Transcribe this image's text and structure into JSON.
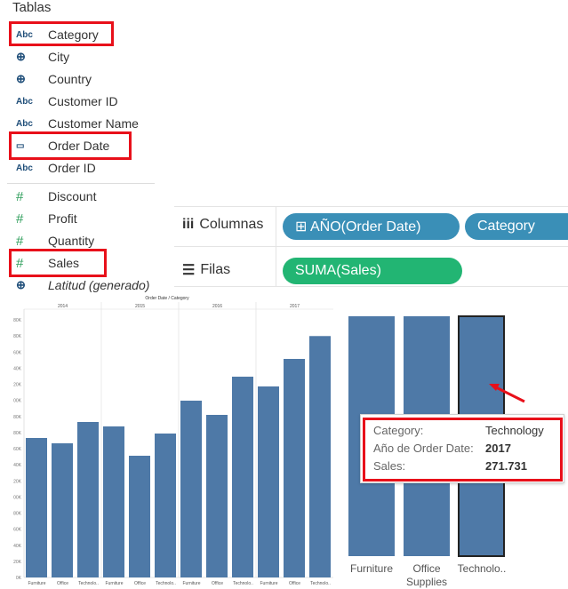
{
  "data_pane": {
    "title": "Tablas",
    "dimensions": [
      {
        "icon": "Abc",
        "icon_name": "string-icon",
        "name": "Category"
      },
      {
        "icon": "⊕",
        "icon_name": "globe-icon",
        "name": "City"
      },
      {
        "icon": "⊕",
        "icon_name": "globe-icon",
        "name": "Country"
      },
      {
        "icon": "Abc",
        "icon_name": "string-icon",
        "name": "Customer ID"
      },
      {
        "icon": "Abc",
        "icon_name": "string-icon",
        "name": "Customer Name"
      },
      {
        "icon": "▭",
        "icon_name": "calendar-icon",
        "name": "Order Date"
      },
      {
        "icon": "Abc",
        "icon_name": "string-icon",
        "name": "Order ID"
      }
    ],
    "measures": [
      {
        "icon": "#",
        "icon_name": "number-icon",
        "name": "Discount"
      },
      {
        "icon": "#",
        "icon_name": "number-icon",
        "name": "Profit"
      },
      {
        "icon": "#",
        "icon_name": "number-icon",
        "name": "Quantity"
      },
      {
        "icon": "#",
        "icon_name": "number-icon",
        "name": "Sales"
      },
      {
        "icon": "⊕",
        "icon_name": "globe-icon",
        "name": "Latitud (generado)"
      }
    ]
  },
  "shelves": {
    "columns_label": "Columnas",
    "columns_pills": [
      "⊞ AÑO(Order Date)",
      "Category"
    ],
    "rows_label": "Filas",
    "rows_pills": [
      "SUMA(Sales)"
    ]
  },
  "small_chart": {
    "title": "Order Date / Category",
    "years": [
      "2014",
      "2015",
      "2016",
      "2017"
    ],
    "yticks": [
      "80K",
      "80K",
      "60K",
      "40K",
      "20K",
      "00K",
      "80K",
      "80K",
      "60K",
      "40K",
      "20K",
      "00K",
      "80K",
      "60K",
      "40K",
      "20K",
      "0K"
    ],
    "xlabels": [
      "Furniture",
      "Office",
      "Technolo..",
      "Furniture",
      "Office",
      "Technolo..",
      "Furniture",
      "Office",
      "Technolo..",
      "Furniture",
      "Office",
      "Technolo.."
    ]
  },
  "chart_data": {
    "type": "bar",
    "categories": [
      "2014 Furniture",
      "2014 Office Supplies",
      "2014 Technology",
      "2015 Furniture",
      "2015 Office Supplies",
      "2015 Technology",
      "2016 Furniture",
      "2016 Office Supplies",
      "2016 Technology",
      "2017 Furniture",
      "2017 Office Supplies",
      "2017 Technology"
    ],
    "values": [
      157000,
      151000,
      175000,
      170000,
      137000,
      162000,
      199000,
      183000,
      226000,
      215000,
      246000,
      271731
    ],
    "title": "Order Date / Category",
    "ylim": [
      0,
      290000
    ]
  },
  "big_chart": {
    "xlabels": [
      "Furniture",
      "Office\nSupplies",
      "Technolo.."
    ]
  },
  "tooltip": {
    "rows": [
      {
        "k": "Category:",
        "v": "Technology"
      },
      {
        "k": "Año de Order Date:",
        "v": "2017"
      },
      {
        "k": "Sales:",
        "v": "271.731"
      }
    ]
  },
  "colors": {
    "bar": "#4e79a7",
    "highlight": "#e8101a",
    "pill_blue": "#3a8fb7",
    "pill_green": "#22b573"
  }
}
